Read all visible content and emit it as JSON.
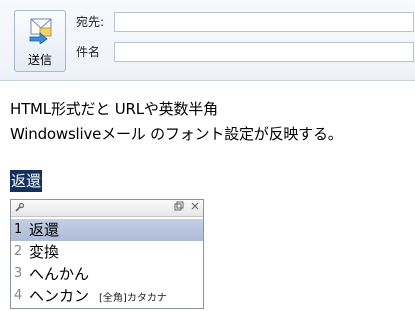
{
  "toolbar": {
    "send_label": "送信"
  },
  "fields": {
    "to_label": "宛先:",
    "to_value": "",
    "subject_label": "件名",
    "subject_value": ""
  },
  "body": {
    "line1": "HTML形式だと URLや英数半角",
    "line2": "Windowsliveメール のフォント設定が反映する。",
    "composition": "返還"
  },
  "candidates": [
    {
      "num": "1",
      "text": "返還",
      "note": ""
    },
    {
      "num": "2",
      "text": "変換",
      "note": ""
    },
    {
      "num": "3",
      "text": "へんかん",
      "note": ""
    },
    {
      "num": "4",
      "text": "ヘンカン",
      "note": "[全角]カタカナ"
    }
  ],
  "icons": {
    "send": "send-mail-icon",
    "wrench": "wrench-icon",
    "restore": "restore-icon",
    "close": "close-icon"
  }
}
